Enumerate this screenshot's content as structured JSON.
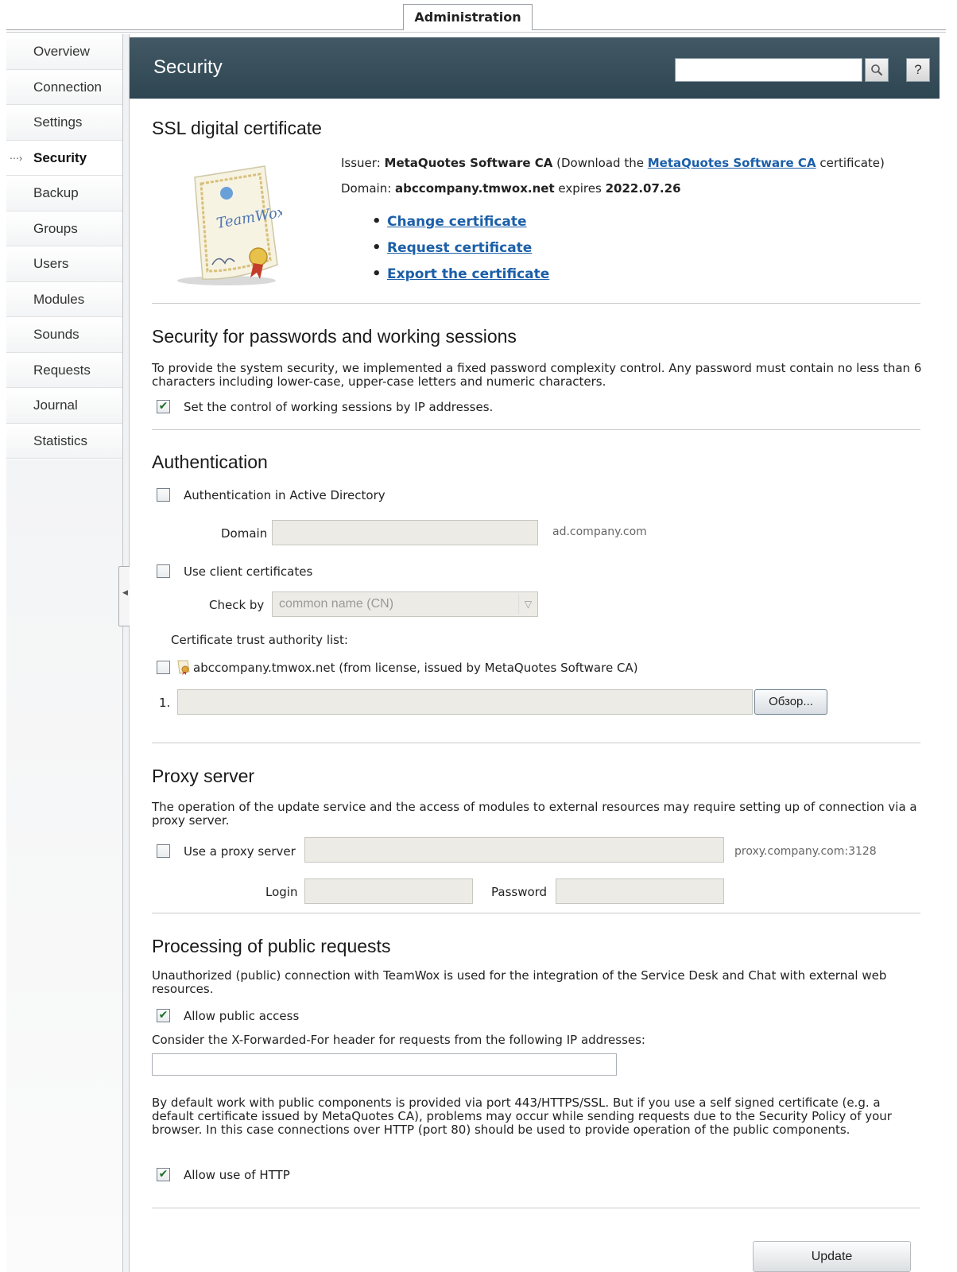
{
  "top_tab": "Administration",
  "sidebar": {
    "items": [
      {
        "label": "Overview"
      },
      {
        "label": "Connection"
      },
      {
        "label": "Settings"
      },
      {
        "label": "Security",
        "active": true
      },
      {
        "label": "Backup"
      },
      {
        "label": "Groups"
      },
      {
        "label": "Users"
      },
      {
        "label": "Modules"
      },
      {
        "label": "Sounds"
      },
      {
        "label": "Requests"
      },
      {
        "label": "Journal"
      },
      {
        "label": "Statistics"
      }
    ]
  },
  "header": {
    "title": "Security",
    "search_value": "",
    "search_icon": "magnifier-icon",
    "help_label": "?"
  },
  "ssl": {
    "heading": "SSL digital certificate",
    "issuer_label": "Issuer:",
    "issuer_name": "MetaQuotes Software CA",
    "download_prefix": "(Download the",
    "download_link": "MetaQuotes Software CA",
    "download_suffix": "certificate)",
    "domain_label": "Domain:",
    "domain_value": "abccompany.tmwox.net",
    "expires_label": "expires",
    "expires_value": "2022.07.26",
    "links": [
      "Change certificate",
      "Request certificate",
      "Export the certificate"
    ]
  },
  "passwords": {
    "heading": "Security for passwords and working sessions",
    "description": "To provide the system security, we implemented a fixed password complexity control. Any password must contain no less than 6 characters including lower-case, upper-case letters and numeric characters.",
    "ip_control_label": "Set the control of working sessions by IP addresses.",
    "ip_control_checked": true
  },
  "auth": {
    "heading": "Authentication",
    "ad_label": "Authentication in Active Directory",
    "ad_checked": false,
    "domain_label": "Domain",
    "domain_value": "",
    "domain_hint": "ad.company.com",
    "client_cert_label": "Use client certificates",
    "client_cert_checked": false,
    "check_by_label": "Check by",
    "check_by_value": "common name (CN)",
    "trust_list_label": "Certificate trust authority list:",
    "trust_item_label": "abccompany.tmwox.net (from license, issued by MetaQuotes Software CA)",
    "trust_item_checked": false,
    "file_index": "1.",
    "file_value": "",
    "browse_label": "Обзор..."
  },
  "proxy": {
    "heading": "Proxy server",
    "description": "The operation of the update service and the access of modules to external resources may require setting up of connection via a proxy server.",
    "use_label": "Use a proxy server",
    "use_checked": false,
    "server_value": "",
    "server_hint": "proxy.company.com:3128",
    "login_label": "Login",
    "login_value": "",
    "password_label": "Password",
    "password_value": ""
  },
  "public": {
    "heading": "Processing of public requests",
    "description": "Unauthorized (public) connection with TeamWox is used for the integration of the Service Desk and Chat with external web resources.",
    "allow_public_label": "Allow public access",
    "allow_public_checked": true,
    "xff_label": "Consider the X-Forwarded-For header for requests from the following IP addresses:",
    "xff_value": "",
    "http_description": "By default work with public components is provided via port 443/HTTPS/SSL. But if you use a self signed certificate (e.g. a default certificate issued by MetaQuotes CA), problems may occur while sending requests due to the Security Policy of your browser. In this case connections over HTTP (port 80) should be used to provide operation of the public components.",
    "allow_http_label": "Allow use of HTTP",
    "allow_http_checked": true
  },
  "update_label": "Update"
}
